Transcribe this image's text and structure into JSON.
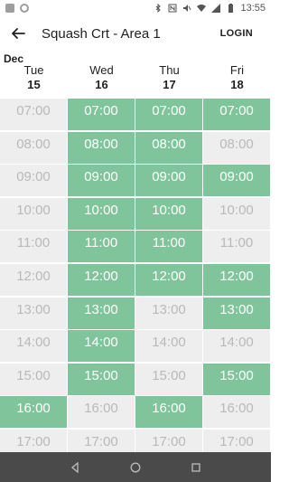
{
  "status_bar": {
    "time": "13:55"
  },
  "app_bar": {
    "title": "Squash Crt - Area 1",
    "login_label": "LOGIN"
  },
  "calendar": {
    "month": "Dec",
    "days": [
      {
        "name": "Tue",
        "num": "15"
      },
      {
        "name": "Wed",
        "num": "16"
      },
      {
        "name": "Thu",
        "num": "17"
      },
      {
        "name": "Fri",
        "num": "18"
      }
    ],
    "times": [
      "07:00",
      "08:00",
      "09:00",
      "10:00",
      "11:00",
      "12:00",
      "13:00",
      "14:00",
      "15:00",
      "16:00",
      "17:00"
    ],
    "availability": [
      [
        false,
        false,
        false,
        false,
        false,
        false,
        false,
        false,
        false,
        true,
        false
      ],
      [
        true,
        true,
        true,
        true,
        true,
        true,
        true,
        true,
        true,
        false,
        false
      ],
      [
        true,
        true,
        true,
        true,
        true,
        true,
        false,
        false,
        false,
        true,
        false
      ],
      [
        true,
        false,
        true,
        false,
        false,
        true,
        true,
        false,
        true,
        false,
        false
      ]
    ],
    "colors": {
      "available": "#80c49b",
      "unavailable": "#eeeeee"
    }
  }
}
